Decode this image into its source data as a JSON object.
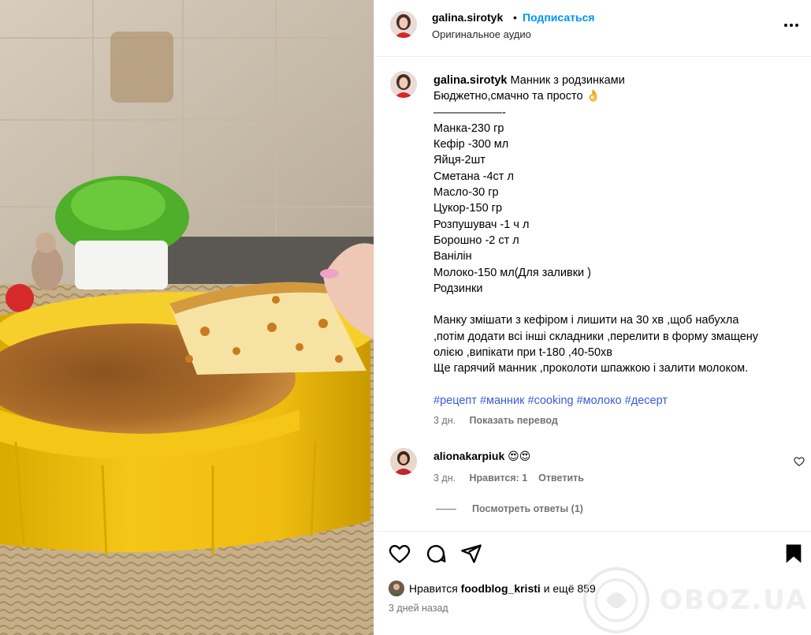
{
  "post": {
    "username": "galina.sirotyk",
    "dot": "•",
    "follow_label": "Подписаться",
    "audio_label": "Оригинальное аудио",
    "more_icon": "more-horizontal-icon"
  },
  "caption": {
    "username": "galina.sirotyk",
    "title": "Манник з родзинками",
    "lines": [
      "Бюджетно,смачно та просто 👌",
      "——————-",
      "Манка-230 гр",
      "Кефір -300 мл",
      "Яйця-2шт",
      "Сметана -4ст л",
      "Масло-30 гр",
      "Цукор-150 гр",
      "Розпушувач -1 ч л",
      "Борошно -2 ст л",
      "Ванілін",
      "Молоко-150 мл(Для заливки )",
      "Родзинки",
      "",
      "Манку змішати з кефіром і лишити на 30 хв ,щоб набухла",
      ",потім додати всі інші складники ,перелити в форму змащену",
      "олією ,випікати при t-180 ,40-50хв",
      "Ще гарячий манник ,проколоти шпажкою і залити молоком.",
      ""
    ],
    "hashtags": [
      "#рецепт",
      "#манник",
      "#cooking",
      "#молоко",
      "#десерт"
    ],
    "time": "3 дн.",
    "translate_label": "Показать перевод"
  },
  "comment": {
    "username": "alionakarpiuk",
    "text": "😍😍",
    "time": "3 дн.",
    "likes_label": "Нравится: 1",
    "reply_label": "Ответить",
    "view_replies_label": "Посмотреть ответы (1)"
  },
  "actions": {
    "like_icon": "heart-icon",
    "comment_icon": "comment-icon",
    "share_icon": "share-icon",
    "save_icon": "bookmark-icon"
  },
  "likes": {
    "prefix": "Нравится",
    "user": "foodblog_kristi",
    "suffix": "и ещё 859"
  },
  "date_label": "3 дней назад",
  "watermark": "OBOZ.UA",
  "colors": {
    "link_blue": "#0095f6",
    "hashtag_blue": "#3a5ae0",
    "muted": "#737373",
    "mold_yellow": "#f1c40f"
  }
}
